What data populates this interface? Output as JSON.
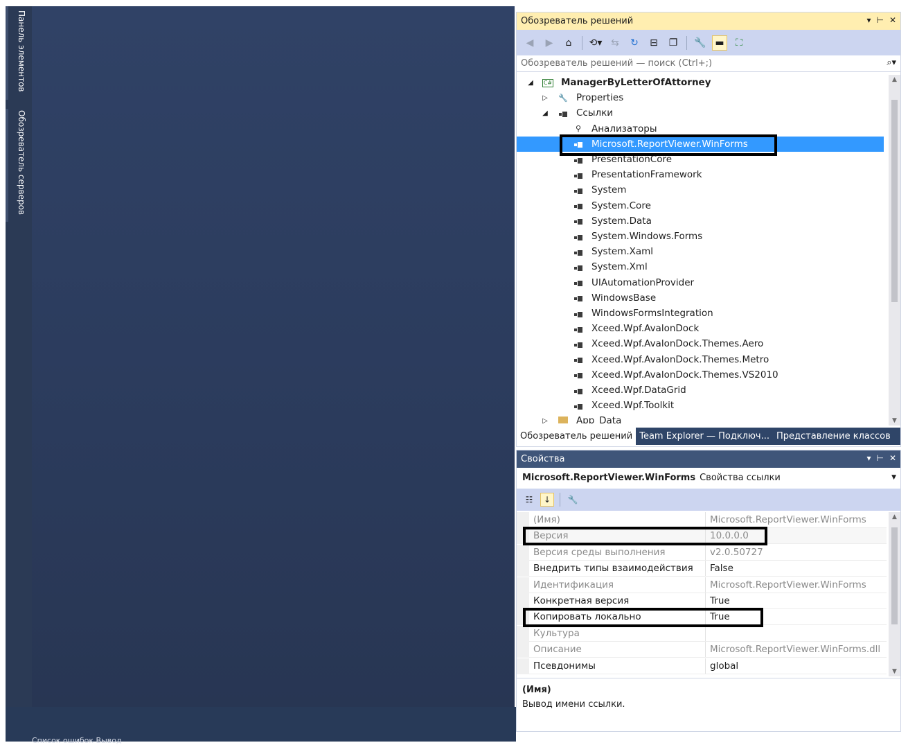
{
  "side_tabs": [
    {
      "label": "Панель элементов"
    },
    {
      "label": "Обозреватель серверов"
    }
  ],
  "bottom_status": "Список ошибок   Вывод",
  "solution_explorer": {
    "title": "Обозреватель решений",
    "title_buttons": [
      "▾",
      "⊢",
      "✕"
    ],
    "search_placeholder": "Обозреватель решений — поиск (Ctrl+;)",
    "toolbar": [
      "back-icon",
      "forward-icon",
      "home-icon",
      "history-icon",
      "sync-icon",
      "refresh-icon",
      "collapse-icon",
      "copy-icon",
      "properties-icon",
      "show-all-icon",
      "class-diagram-icon"
    ],
    "tree": [
      {
        "label": "ManagerByLetterOfAttorney",
        "level": 0,
        "expanded": true,
        "icon": "csharp-project-icon",
        "bold": true
      },
      {
        "label": "Properties",
        "level": 1,
        "expanded": false,
        "icon": "wrench-icon"
      },
      {
        "label": "Ссылки",
        "level": 1,
        "expanded": true,
        "icon": "references-icon"
      },
      {
        "label": "Анализаторы",
        "level": 2,
        "icon": "analyzers-icon"
      },
      {
        "label": "Microsoft.ReportViewer.WinForms",
        "level": 2,
        "icon": "reference-icon",
        "selected": true
      },
      {
        "label": "PresentationCore",
        "level": 2,
        "icon": "reference-icon"
      },
      {
        "label": "PresentationFramework",
        "level": 2,
        "icon": "reference-icon"
      },
      {
        "label": "System",
        "level": 2,
        "icon": "reference-icon"
      },
      {
        "label": "System.Core",
        "level": 2,
        "icon": "reference-icon"
      },
      {
        "label": "System.Data",
        "level": 2,
        "icon": "reference-icon"
      },
      {
        "label": "System.Windows.Forms",
        "level": 2,
        "icon": "reference-icon"
      },
      {
        "label": "System.Xaml",
        "level": 2,
        "icon": "reference-icon"
      },
      {
        "label": "System.Xml",
        "level": 2,
        "icon": "reference-icon"
      },
      {
        "label": "UIAutomationProvider",
        "level": 2,
        "icon": "reference-icon"
      },
      {
        "label": "WindowsBase",
        "level": 2,
        "icon": "reference-icon"
      },
      {
        "label": "WindowsFormsIntegration",
        "level": 2,
        "icon": "reference-icon"
      },
      {
        "label": "Xceed.Wpf.AvalonDock",
        "level": 2,
        "icon": "reference-icon"
      },
      {
        "label": "Xceed.Wpf.AvalonDock.Themes.Aero",
        "level": 2,
        "icon": "reference-icon"
      },
      {
        "label": "Xceed.Wpf.AvalonDock.Themes.Metro",
        "level": 2,
        "icon": "reference-icon"
      },
      {
        "label": "Xceed.Wpf.AvalonDock.Themes.VS2010",
        "level": 2,
        "icon": "reference-icon"
      },
      {
        "label": "Xceed.Wpf.DataGrid",
        "level": 2,
        "icon": "reference-icon"
      },
      {
        "label": "Xceed.Wpf.Toolkit",
        "level": 2,
        "icon": "reference-icon"
      },
      {
        "label": "App_Data",
        "level": 1,
        "expanded": false,
        "icon": "folder-icon"
      }
    ],
    "tabs": [
      {
        "label": "Обозреватель решений",
        "active": true
      },
      {
        "label": "Team Explorer — Подключ...",
        "active": false
      },
      {
        "label": "Представление классов",
        "active": false
      }
    ]
  },
  "properties": {
    "title": "Свойства",
    "title_buttons": [
      "▾",
      "⊢",
      "✕"
    ],
    "object_name": "Microsoft.ReportViewer.WinForms",
    "object_type": "Свойства ссылки",
    "rows": [
      {
        "name": "(Имя)",
        "value": "Microsoft.ReportViewer.WinForms",
        "readonly": true
      },
      {
        "name": "Версия",
        "value": "10.0.0.0",
        "readonly": true
      },
      {
        "name": "Версия среды выполнения",
        "value": "v2.0.50727",
        "readonly": true
      },
      {
        "name": "Внедрить типы взаимодействия",
        "value": "False",
        "readonly": false
      },
      {
        "name": "Идентификация",
        "value": "Microsoft.ReportViewer.WinForms",
        "readonly": true
      },
      {
        "name": "Конкретная версия",
        "value": "True",
        "readonly": false
      },
      {
        "name": "Копировать локально",
        "value": "True",
        "readonly": false
      },
      {
        "name": "Культура",
        "value": "",
        "readonly": true
      },
      {
        "name": "Описание",
        "value": "Microsoft.ReportViewer.WinForms.dll",
        "readonly": true
      },
      {
        "name": "Псевдонимы",
        "value": "global",
        "readonly": false
      }
    ],
    "description_title": "(Имя)",
    "description_text": "Вывод имени ссылки."
  },
  "colors": {
    "title_active": "#ffeeb0",
    "title_inactive": "#3f5579",
    "selection": "#3399ff",
    "editor_bg": "#2b3b5c"
  }
}
